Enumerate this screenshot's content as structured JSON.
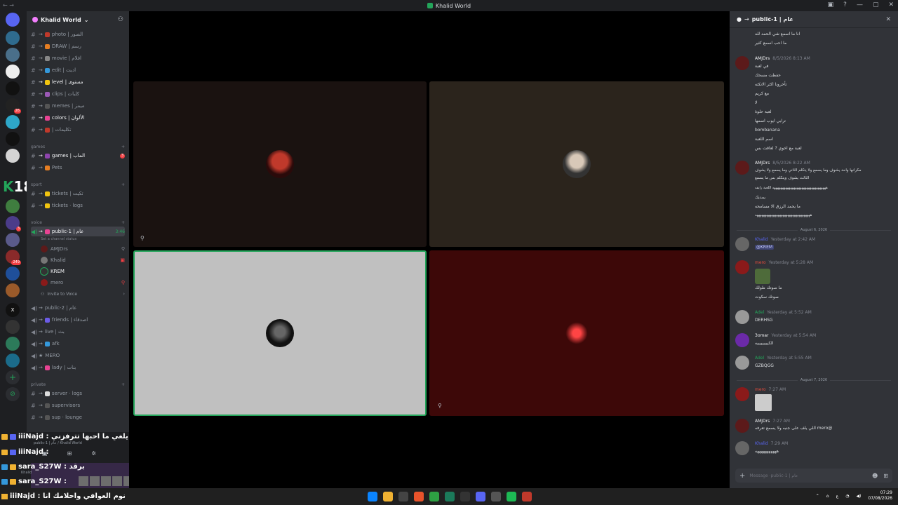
{
  "window": {
    "title": "Khalid World"
  },
  "server": {
    "name": "Khalid World"
  },
  "channels": [
    {
      "name": "photo | الصور"
    },
    {
      "name": "DRAW | رسم"
    },
    {
      "name": "movie | افلام"
    },
    {
      "name": "edit | اديت"
    },
    {
      "name": "level | مستوى"
    },
    {
      "name": "clips | كلبات"
    },
    {
      "name": "memes | ميمز"
    },
    {
      "name": "colors | الألوان"
    },
    {
      "name": "| تكليمات"
    }
  ],
  "categories": {
    "games": "games",
    "sport": "sport",
    "voice": "voice",
    "private": "private"
  },
  "games_channels": [
    {
      "name": "games | الماب",
      "badge": "3"
    },
    {
      "name": "Pets"
    }
  ],
  "sport_channels": [
    {
      "name": "tickets | تكيت"
    },
    {
      "name": "tickets · logs"
    }
  ],
  "voice": {
    "active_channel": "public-1 | عام",
    "timer": "3:46",
    "status": "Set a channel status",
    "users": [
      "AMJDrs",
      "Khalid",
      "KREM",
      "mero"
    ],
    "invite": "Invite to Voice",
    "other_channels": [
      {
        "name": "public-2 | عام"
      },
      {
        "name": "friends | اصدقاء"
      },
      {
        "name": "live | بث"
      },
      {
        "name": "afk"
      },
      {
        "name": "MERO"
      },
      {
        "name": "lady | بنات"
      }
    ]
  },
  "private_channels": [
    {
      "name": "server · logs"
    },
    {
      "name": "supervisors"
    },
    {
      "name": "sup · lounge"
    }
  ],
  "overlay": {
    "line1": "iiiNajd : يلغي ما احبها تترفزني",
    "line2": "iiiNajd :",
    "line3": "sara_S27W : برقد",
    "line4": "sara_S27W :",
    "line5": "iiiNajd : نوم العوافي واحلامك انا",
    "sub1": "public-1 | عام / Khalid World",
    "sub2": "Khalid"
  },
  "rail": {
    "big_label": "18"
  },
  "chat": {
    "header": "public-1 | عام",
    "composer_placeholder": "Message ·public-1 | عام",
    "top_lines": [
      "انا ما اسمع شي الحمد لله",
      "ما احب اسمع كثير"
    ],
    "messages": [
      {
        "author": "AMJDrs",
        "time": "8/5/2026 8:13 AM",
        "lines": [
          "في لعبة",
          "حفظت مسحك",
          "تأخرونا اكثر الانكته",
          "مع كريم",
          "لا",
          "لعبة حلوة",
          "ترابي ابوب اسمها",
          "bombanana",
          "اسم اللعبة",
          "لعبة مع اخوي ? لعاقت بس"
        ]
      },
      {
        "author": "AMJDrs",
        "time": "8/5/2026 8:22 AM",
        "lines": [
          "مكرانها واحد يشوف وما يسمع ولا يتكلم الثاني وما يسمع ولا يشوف",
          "الثالث يشوف ويتكلم بس ما يسمع",
          "هههههههههههههههههههههههههههههههههه اللعبة رايقه",
          "يمديك",
          "ما يحمد الرزق الا مسامحه",
          "ههههههههههههههههههههههههههههههههههه"
        ]
      }
    ],
    "date_aug6": "August 6, 2026",
    "date_aug7": "August 7, 2026",
    "aug6": [
      {
        "author": "Khalid",
        "time": "Yesterday at 2:42 AM",
        "text": "@KREM"
      },
      {
        "author": "mero",
        "time": "Yesterday at 5:28 AM",
        "lines": [
          "ما صوتك طولك",
          "صوتك سكوت"
        ]
      },
      {
        "author": "Adel",
        "time": "Yesterday at 5:52 AM",
        "text": "DERHSG"
      },
      {
        "author": "3omar",
        "time": "Yesterday at 5:54 AM",
        "text": "الكيييييييييه"
      },
      {
        "author": "Adel",
        "time": "Yesterday at 5:55 AM",
        "text": "GZBQGG"
      }
    ],
    "aug7": [
      {
        "author": "mero",
        "time": "7:27 AM"
      },
      {
        "author": "AMJDrs",
        "time": "7:27 AM",
        "text": "@mero اللي يلف على جنبه ولا يسمع تعرفه"
      },
      {
        "author": "Khalid",
        "time": "7:29 AM",
        "text": "هههههههههههه"
      }
    ]
  },
  "taskbar": {
    "time": "07:29",
    "date": "07/08/2026",
    "lang": "ع"
  }
}
